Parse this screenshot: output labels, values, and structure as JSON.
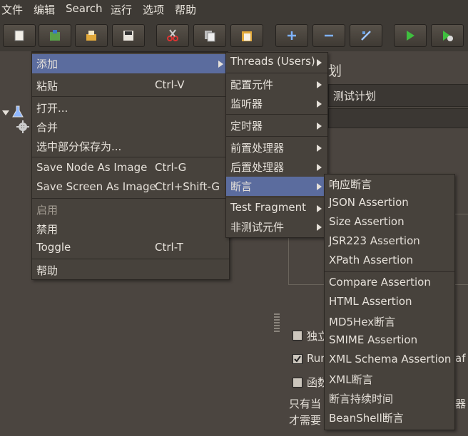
{
  "menubar": [
    "文件",
    "编辑",
    "Search",
    "运行",
    "选项",
    "帮助"
  ],
  "toolbar": [
    "new-icon",
    "template-icon",
    "open-icon",
    "save-icon",
    "cut-icon",
    "copy-icon",
    "paste-icon",
    "expand-icon",
    "collapse-icon",
    "toggle-icon",
    "start-icon",
    "start-no-pause-icon"
  ],
  "panel": {
    "title_partial": "划",
    "name_value": "测试计划"
  },
  "background_labels": {
    "independent": "独立",
    "run": "Run",
    "run_suffix": "af",
    "functional": "函数",
    "only_when": "只有当",
    "need": "才需要",
    "right_fragment": "器"
  },
  "context_menu": {
    "items": [
      {
        "label": "添加",
        "submenu": true,
        "selected": true
      },
      {
        "label": "粘贴",
        "shortcut": "Ctrl-V"
      },
      {
        "label": "打开..."
      },
      {
        "label": "合并"
      },
      {
        "label": "选中部分保存为..."
      },
      {
        "label": "Save Node As Image",
        "shortcut": "Ctrl-G"
      },
      {
        "label": "Save Screen As Image",
        "shortcut": "Ctrl+Shift-G"
      },
      {
        "label": "启用",
        "disabled": true
      },
      {
        "label": "禁用"
      },
      {
        "label": "Toggle",
        "shortcut": "Ctrl-T"
      },
      {
        "label": "帮助"
      }
    ]
  },
  "add_submenu": {
    "items": [
      {
        "label": "Threads (Users)"
      },
      {
        "label": "配置元件"
      },
      {
        "label": "监听器"
      },
      {
        "label": "定时器"
      },
      {
        "label": "前置处理器"
      },
      {
        "label": "后置处理器"
      },
      {
        "label": "断言",
        "selected": true
      },
      {
        "label": "Test Fragment"
      },
      {
        "label": "非测试元件"
      }
    ]
  },
  "assertion_submenu": {
    "items": [
      "响应断言",
      "JSON Assertion",
      "Size Assertion",
      "JSR223 Assertion",
      "XPath Assertion",
      "Compare Assertion",
      "HTML Assertion",
      "MD5Hex断言",
      "SMIME Assertion",
      "XML Schema Assertion",
      "XML断言",
      "断言持续时间",
      "BeanShell断言"
    ]
  }
}
